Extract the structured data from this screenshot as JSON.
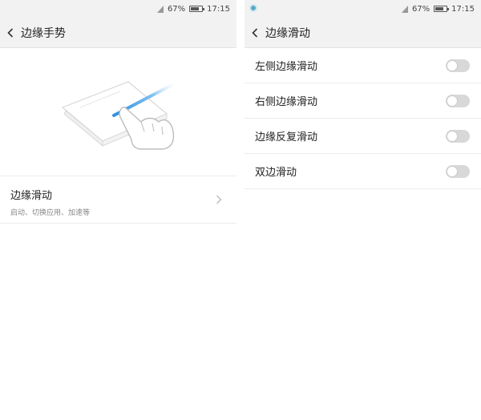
{
  "left_screen": {
    "status": {
      "battery": "67%",
      "time": "17:15",
      "battery_level": 0.67
    },
    "header": {
      "title": "边缘手势"
    },
    "menu": {
      "title": "边缘滑动",
      "subtitle": "启动、切换应用、加速等"
    }
  },
  "right_screen": {
    "status": {
      "battery": "67%",
      "time": "17:15",
      "battery_level": 0.67
    },
    "header": {
      "title": "边缘滑动"
    },
    "toggles": [
      {
        "label": "左侧边缘滑动",
        "on": false
      },
      {
        "label": "右侧边缘滑动",
        "on": false
      },
      {
        "label": "边缘反复滑动",
        "on": false
      },
      {
        "label": "双边滑动",
        "on": false
      }
    ]
  },
  "colors": {
    "accent_blue": "#4a9fe0",
    "toggle_off": "#d8d8d8"
  }
}
